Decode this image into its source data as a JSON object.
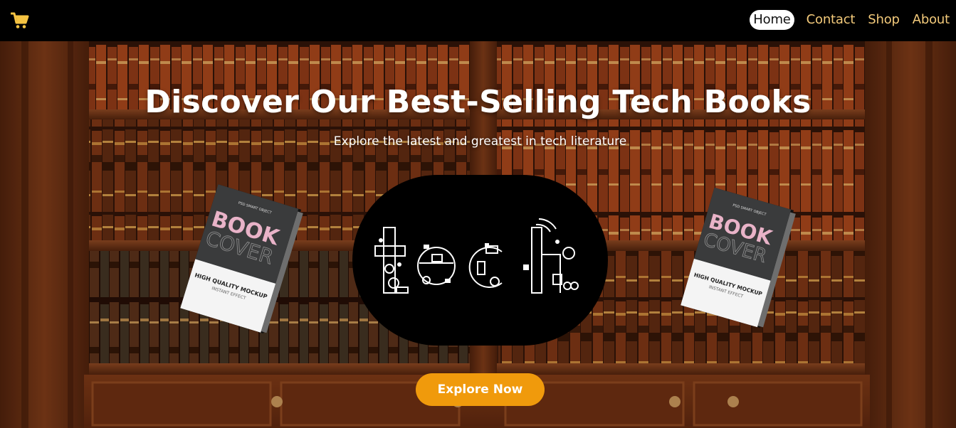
{
  "nav": {
    "cart_icon": "shopping-cart-icon",
    "links": [
      {
        "label": "Home",
        "active": true
      },
      {
        "label": "Contact",
        "active": false
      },
      {
        "label": "Shop",
        "active": false
      },
      {
        "label": "About",
        "active": false
      }
    ]
  },
  "hero": {
    "title": "Discover Our Best-Selling Tech Books",
    "subtitle": "Explore the latest and greatest in tech literature",
    "button_label": "Explore Now",
    "logo_text": "tech",
    "book_left": {
      "small_label": "PSD SMART OBJECT",
      "title_line1": "BOOK",
      "title_line2": "COVER",
      "tagline": "HIGH QUALITY MOCKUP",
      "sub_tagline": "INSTANT EFFECT"
    },
    "book_right": {
      "small_label": "PSD SMART OBJECT",
      "title_line1": "BOOK",
      "title_line2": "COVER",
      "tagline": "HIGH QUALITY MOCKUP",
      "sub_tagline": "INSTANT EFFECT"
    }
  },
  "colors": {
    "navbar_bg": "#000000",
    "nav_link": "#f2c97a",
    "cart": "#f5c342",
    "button_bg": "#f09a0c",
    "book_title_pink": "#e9b3c8",
    "wood": "#5a2a12"
  }
}
